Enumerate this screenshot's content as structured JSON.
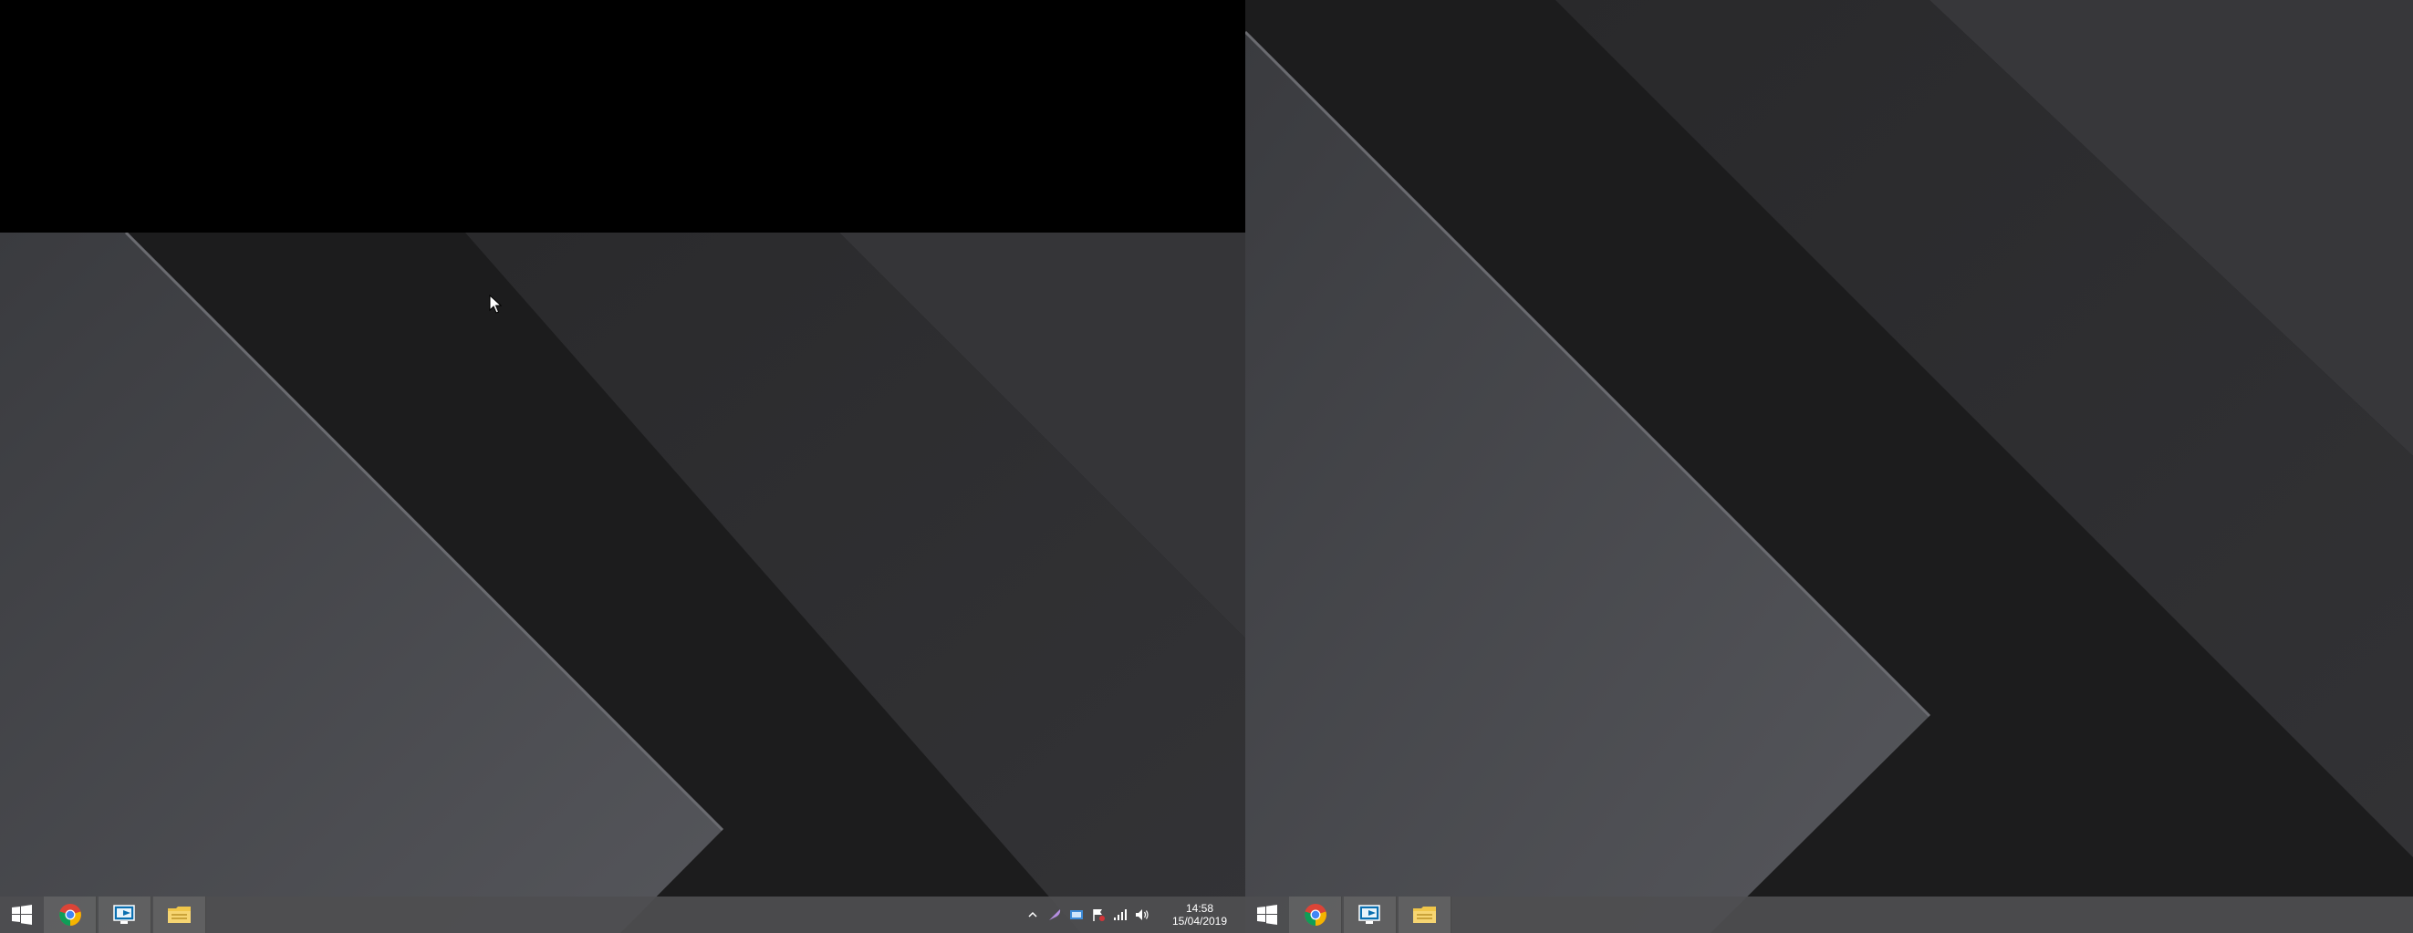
{
  "taskbar_left": {
    "start": {
      "icon": "windows-logo-icon"
    },
    "pinned": [
      {
        "name": "chrome",
        "icon": "chrome-icon"
      },
      {
        "name": "remote-desktop",
        "icon": "remote-desktop-icon"
      },
      {
        "name": "file-explorer",
        "icon": "folder-icon"
      }
    ],
    "tray": {
      "icons": [
        "chevron-up-icon",
        "feather-icon",
        "network-drive-icon",
        "flag-icon",
        "signal-icon",
        "volume-icon"
      ],
      "time": "14:58",
      "date": "15/04/2019"
    }
  },
  "taskbar_right": {
    "start": {
      "icon": "windows-logo-icon"
    },
    "pinned": [
      {
        "name": "chrome",
        "icon": "chrome-icon"
      },
      {
        "name": "remote-desktop",
        "icon": "remote-desktop-icon"
      },
      {
        "name": "file-explorer",
        "icon": "folder-icon"
      }
    ]
  },
  "colors": {
    "taskbar": "#4e4e50",
    "wallpaper_dark": "#1b1b1b",
    "wallpaper_light": "#4a4b4f",
    "chrome_red": "#db4437",
    "chrome_green": "#0f9d58",
    "chrome_yellow": "#f4b400",
    "chrome_blue": "#4285f4",
    "folder_yellow": "#f0c64a"
  }
}
